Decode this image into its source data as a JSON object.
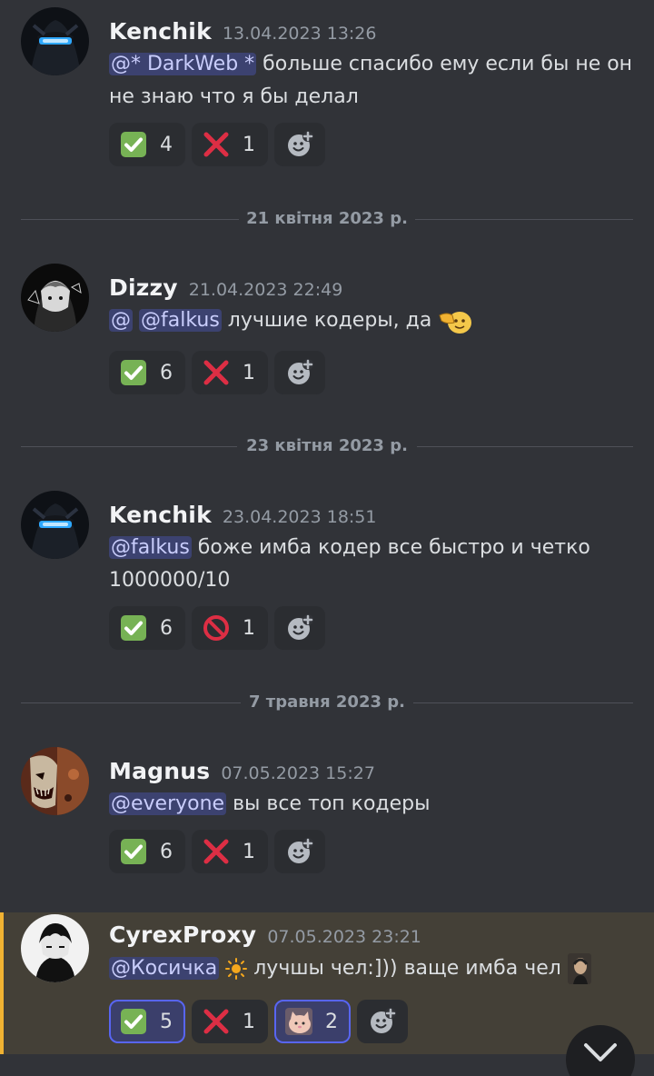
{
  "messages": [
    {
      "username": "Kenchik",
      "timestamp": "13.04.2023 13:26",
      "mention": "@* DarkWeb *",
      "text": " больше спасибо ему если бы не он не знаю что я бы делал",
      "reactions": [
        {
          "icon": "check-mark-icon",
          "count": "4"
        },
        {
          "icon": "cross-mark-icon",
          "count": "1"
        }
      ]
    },
    {
      "username": "Dizzy",
      "timestamp": "21.04.2023 22:49",
      "mention_prefix": "@",
      "mention": "@falkus",
      "text": " лучшие кодеры, да",
      "reactions": [
        {
          "icon": "check-mark-icon",
          "count": "6"
        },
        {
          "icon": "cross-mark-icon",
          "count": "1"
        }
      ]
    },
    {
      "username": "Kenchik",
      "timestamp": "23.04.2023 18:51",
      "mention": "@falkus",
      "text": " боже имба кодер все быстро и четко 1000000/10",
      "reactions": [
        {
          "icon": "check-mark-icon",
          "count": "6"
        },
        {
          "icon": "no-entry-icon",
          "count": "1"
        }
      ]
    },
    {
      "username": "Magnus",
      "timestamp": "07.05.2023 15:27",
      "mention": "@everyone",
      "text": " вы все топ кодеры",
      "reactions": [
        {
          "icon": "check-mark-icon",
          "count": "6"
        },
        {
          "icon": "cross-mark-icon",
          "count": "1"
        }
      ]
    },
    {
      "username": "CyrexProxy",
      "timestamp": "07.05.2023 23:21",
      "mention": "@Косичка",
      "text": " лучшы чел:])) ваще имба чел",
      "reactions": [
        {
          "icon": "check-mark-icon",
          "count": "5"
        },
        {
          "icon": "cross-mark-icon",
          "count": "1"
        },
        {
          "icon": "cat-emoji-icon",
          "count": "2"
        }
      ]
    }
  ],
  "dividers": [
    "21 квітня 2023 р.",
    "23 квітня 2023 р.",
    "7 травня 2023 р."
  ],
  "colors": {
    "background": "#313338",
    "mention_bg": "#3c4270",
    "highlight_bar": "#f0b232"
  }
}
